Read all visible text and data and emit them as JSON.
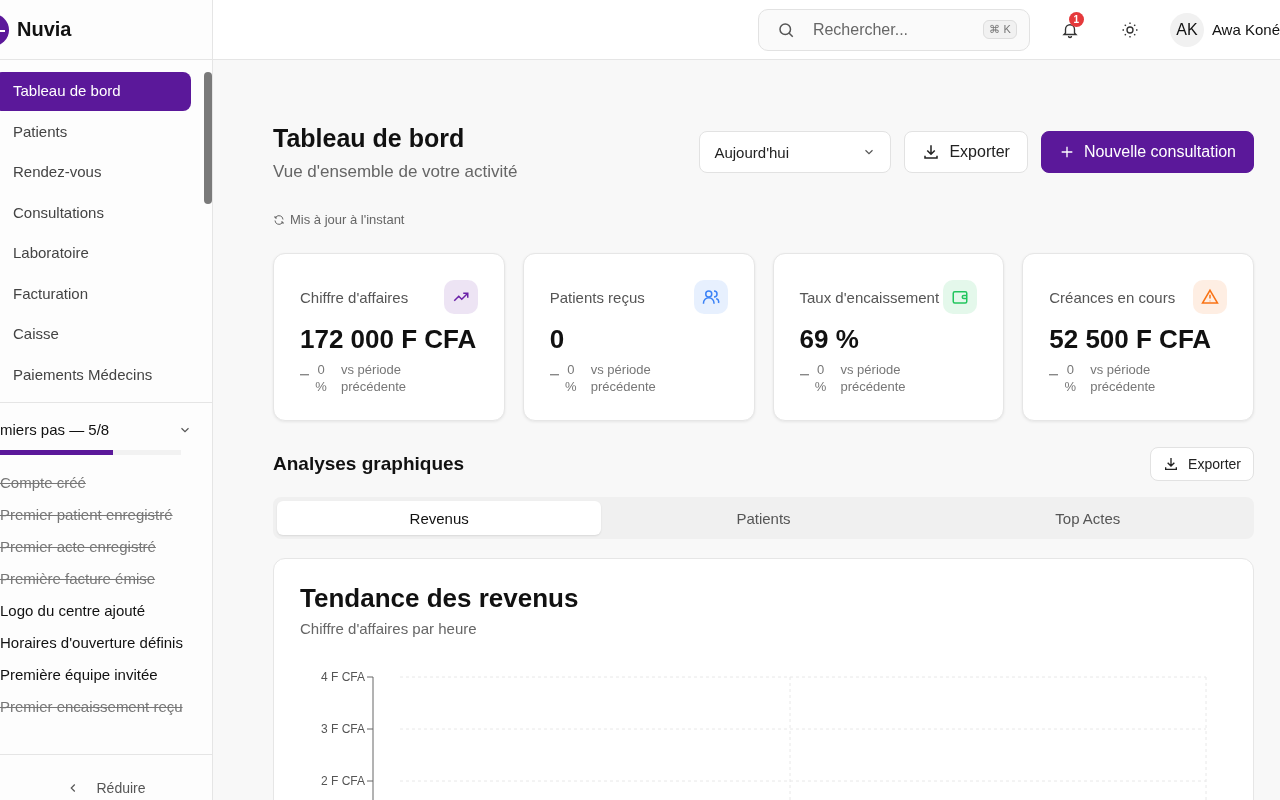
{
  "brand": {
    "name": "Nuvia"
  },
  "sidebar": {
    "items": [
      {
        "label": "Tableau de bord",
        "selected": true
      },
      {
        "label": "Patients",
        "selected": false
      },
      {
        "label": "Rendez-vous",
        "selected": false
      },
      {
        "label": "Consultations",
        "selected": false
      },
      {
        "label": "Laboratoire",
        "selected": false
      },
      {
        "label": "Facturation",
        "selected": false
      },
      {
        "label": "Caisse",
        "selected": false
      },
      {
        "label": "Paiements Médecins",
        "selected": false
      }
    ],
    "checklist": {
      "title": "miers pas — 5/8",
      "level": 0.625,
      "expanded": true,
      "items": [
        {
          "label": "Compte créé",
          "checked": true
        },
        {
          "label": "Premier patient enregistré",
          "checked": true
        },
        {
          "label": "Premier acte enregistré",
          "checked": true
        },
        {
          "label": "Première facture émise",
          "checked": true
        },
        {
          "label": "Logo du centre ajouté",
          "checked": false
        },
        {
          "label": "Horaires d'ouverture définis",
          "checked": false
        },
        {
          "label": "Première équipe invitée",
          "checked": false
        },
        {
          "label": "Premier encaissement reçu",
          "checked": true
        }
      ]
    },
    "collapse": "Réduire"
  },
  "header": {
    "search": {
      "placeholder": "Rechercher...",
      "shortcut": "⌘ K"
    },
    "notifications": "1",
    "user": {
      "initials": "AK",
      "name": "Awa Koné"
    }
  },
  "page": {
    "title": "Tableau de bord",
    "subtitle": "Vue d'ensemble de votre activité",
    "updated": "Mis à jour à l'instant",
    "period": "Aujourd'hui",
    "export": "Exporter",
    "new": "Nouvelle consultation"
  },
  "stats": [
    {
      "label": "Chiffre d'affaires",
      "value": "172 000 F CFA",
      "delta": "0 %",
      "note": "vs période précédente",
      "kind": "trend",
      "color": "#6b21a8"
    },
    {
      "label": "Patients reçus",
      "value": "0",
      "delta": "0 %",
      "note": "vs période précédente",
      "kind": "users",
      "color": "#3b82f6"
    },
    {
      "label": "Taux d'encaissement",
      "value": "69 %",
      "delta": "0 %",
      "note": "vs période précédente",
      "kind": "wallet",
      "color": "#22c55e"
    },
    {
      "label": "Créances en cours",
      "value": "52 500 F CFA",
      "delta": "0 %",
      "note": "vs période précédente",
      "kind": "alert",
      "color": "#f97316"
    }
  ],
  "analyses": {
    "title": "Analyses graphiques",
    "export": "Exporter",
    "tabs": [
      {
        "label": "Revenus",
        "selected": true
      },
      {
        "label": "Patients",
        "selected": false
      },
      {
        "label": "Top Actes",
        "selected": false
      }
    ],
    "chart_card": {
      "title": "Tendance des revenus",
      "subtitle": "Chiffre d'affaires par heure",
      "axis_labels": [
        "4 F CFA",
        "3 F CFA",
        "2 F CFA"
      ]
    }
  }
}
